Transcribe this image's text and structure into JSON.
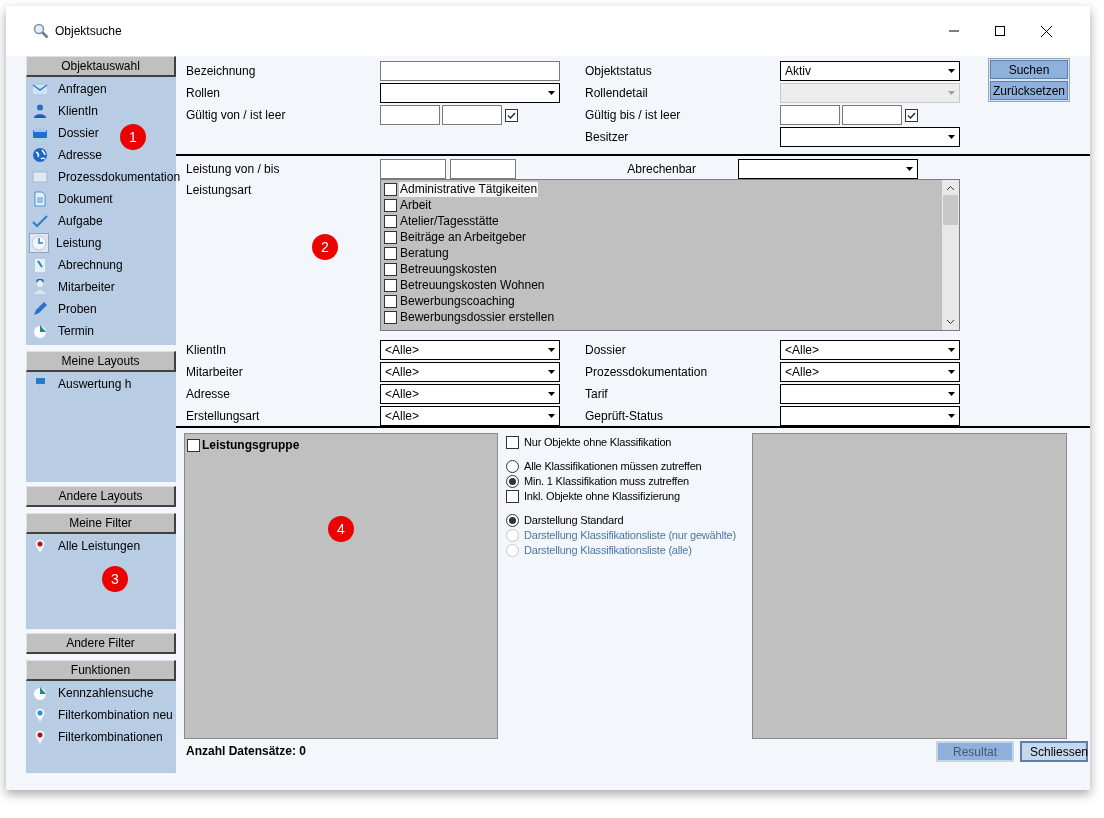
{
  "window": {
    "title": "Objektsuche"
  },
  "sidebar": {
    "groups": [
      {
        "header": "Objektauswahl",
        "items": [
          {
            "label": "Anfragen",
            "selected": false
          },
          {
            "label": "KlientIn",
            "selected": false
          },
          {
            "label": "Dossier",
            "selected": false
          },
          {
            "label": "Adresse",
            "selected": false
          },
          {
            "label": "Prozessdokumentation",
            "selected": false
          },
          {
            "label": "Dokument",
            "selected": false
          },
          {
            "label": "Aufgabe",
            "selected": false
          },
          {
            "label": "Leistung",
            "selected": true
          },
          {
            "label": "Abrechnung",
            "selected": false
          },
          {
            "label": "Mitarbeiter",
            "selected": false
          },
          {
            "label": "Proben",
            "selected": false
          },
          {
            "label": "Termin",
            "selected": false
          }
        ]
      },
      {
        "header": "Meine Layouts",
        "items": [
          {
            "label": "Auswertung h",
            "selected": false
          }
        ],
        "footer": "Andere Layouts"
      },
      {
        "header": "Meine Filter",
        "items": [
          {
            "label": "Alle Leistungen",
            "selected": false
          }
        ],
        "footer": "Andere Filter"
      },
      {
        "header": "Funktionen",
        "items": [
          {
            "label": "Kennzahlensuche",
            "selected": false
          },
          {
            "label": "Filterkombination neu",
            "selected": false
          },
          {
            "label": "Filterkombinationen",
            "selected": false
          }
        ]
      }
    ]
  },
  "top_form": {
    "left": [
      {
        "label": "Bezeichnung",
        "kind": "text"
      },
      {
        "label": "Rollen",
        "kind": "select"
      },
      {
        "label": "Gültig von / ist leer",
        "kind": "daterange",
        "checked": true
      }
    ],
    "right": [
      {
        "label": "Objektstatus",
        "kind": "select",
        "value": "Aktiv",
        "disabled": false
      },
      {
        "label": "Rollendetail",
        "kind": "select",
        "disabled": true
      },
      {
        "label": "Gültig bis / ist leer",
        "kind": "daterange",
        "checked": true,
        "disabled": false
      },
      {
        "label": "Besitzer",
        "kind": "select",
        "disabled": false
      }
    ]
  },
  "search_buttons": [
    {
      "label": "Suchen"
    },
    {
      "label": "Zurücksetzen"
    }
  ],
  "leistung": {
    "range_label": "Leistung von / bis",
    "abrechenbar_label": "Abrechenbar",
    "type_label": "Leistungsart",
    "types": [
      {
        "label": "Administrative Tätgikeiten",
        "checked": false,
        "selected": true
      },
      {
        "label": "Arbeit",
        "checked": false,
        "selected": false
      },
      {
        "label": "Atelier/Tagesstätte",
        "checked": false,
        "selected": false
      },
      {
        "label": "Beiträge an Arbeitgeber",
        "checked": false,
        "selected": false
      },
      {
        "label": "Beratung",
        "checked": false,
        "selected": false
      },
      {
        "label": "Betreuungskosten",
        "checked": false,
        "selected": false
      },
      {
        "label": "Betreuungskosten Wohnen",
        "checked": false,
        "selected": false
      },
      {
        "label": "Bewerbungscoaching",
        "checked": false,
        "selected": false
      },
      {
        "label": "Bewerbungsdossier erstellen",
        "checked": false,
        "selected": false
      }
    ],
    "filters": [
      {
        "label": "KlientIn",
        "value": "<Alle>"
      },
      {
        "label": "Dossier",
        "value": "<Alle>"
      },
      {
        "label": "Mitarbeiter",
        "value": "<Alle>"
      },
      {
        "label": "Prozessdokumentation",
        "value": "<Alle>"
      },
      {
        "label": "Adresse",
        "value": "<Alle>"
      },
      {
        "label": "Tarif"
      },
      {
        "label": "Erstellungsart",
        "value": "<Alle>"
      },
      {
        "label": "Geprüft-Status"
      }
    ]
  },
  "classification": {
    "group_label": "Leistungsgruppe",
    "group_checked": false,
    "option_groups": [
      [
        {
          "kind": "checkbox",
          "label": "Nur Objekte ohne Klassifikation",
          "checked": false,
          "disabled": false
        }
      ],
      [
        {
          "kind": "radio",
          "label": "Alle Klassifikationen müssen zutreffen",
          "checked": false,
          "disabled": false
        },
        {
          "kind": "radio",
          "label": "Min. 1 Klassifikation muss zutreffen",
          "checked": true,
          "disabled": false
        },
        {
          "kind": "checkbox",
          "label": "Inkl. Objekte ohne Klassifizierung",
          "checked": false,
          "disabled": false
        }
      ],
      [
        {
          "kind": "radio",
          "label": "Darstellung Standard",
          "checked": true,
          "disabled": false
        },
        {
          "kind": "radio",
          "label": "Darstellung Klassifikationsliste (nur gewählte)",
          "checked": false,
          "disabled": true
        },
        {
          "kind": "radio",
          "label": "Darstellung Klassifikationsliste (alle)",
          "checked": false,
          "disabled": true
        }
      ]
    ]
  },
  "record_count": "Anzahl Datensätze: 0",
  "footer_buttons": [
    {
      "label": "Resultat",
      "disabled": true
    },
    {
      "label": "Schliessen",
      "disabled": false
    }
  ],
  "markers": [
    {
      "label": "1"
    },
    {
      "label": "2"
    },
    {
      "label": "3"
    },
    {
      "label": "4"
    }
  ]
}
